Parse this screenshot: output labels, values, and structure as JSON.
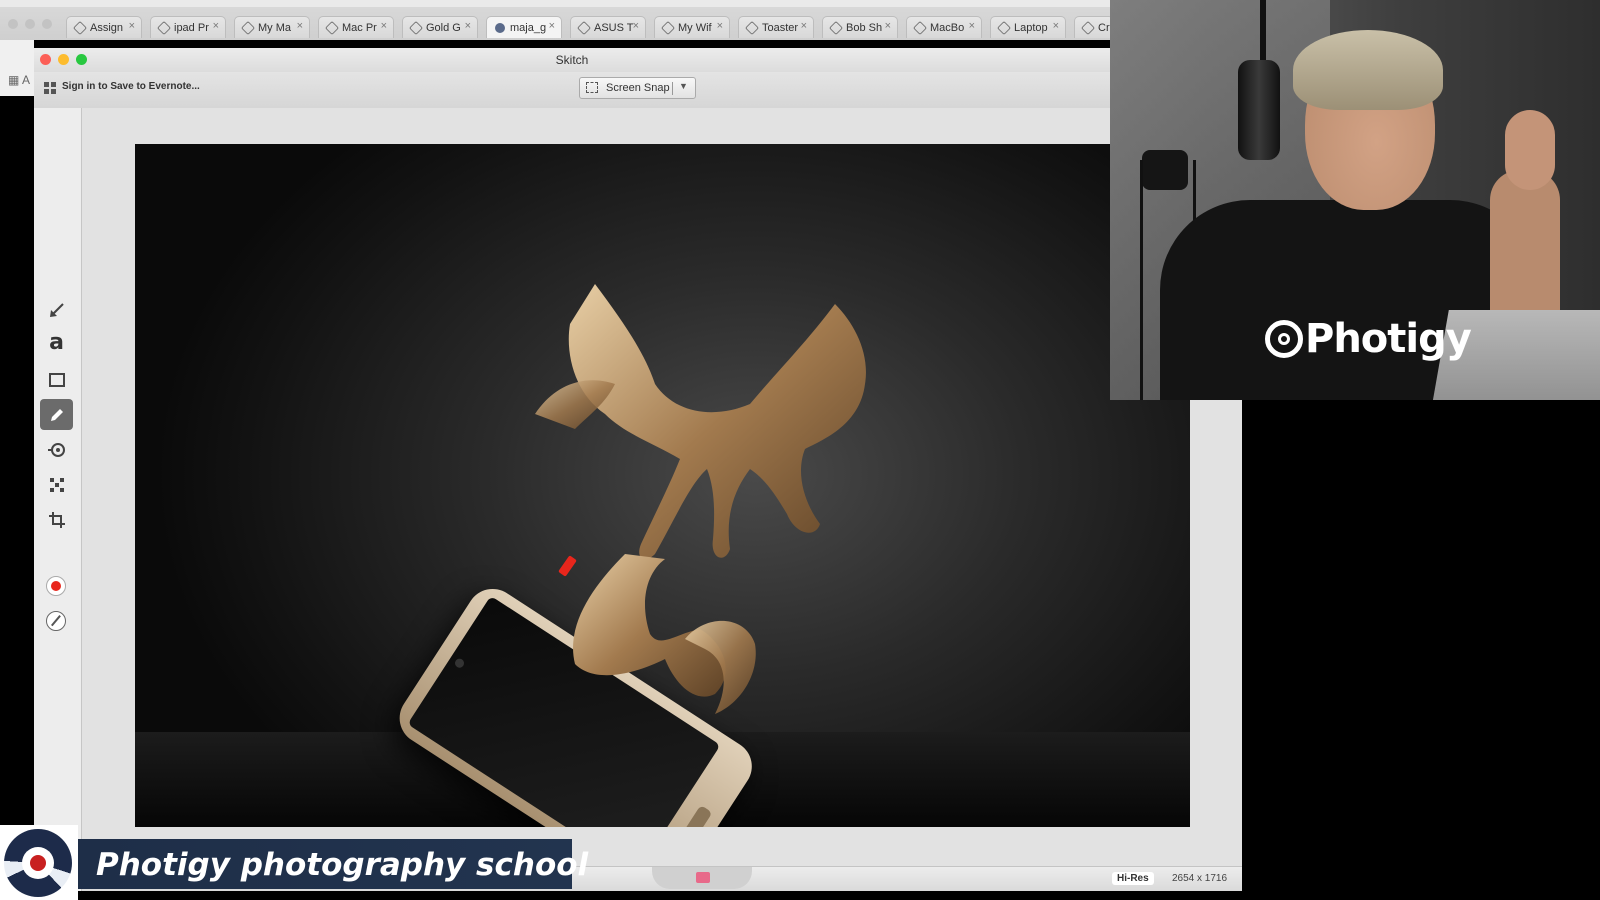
{
  "browser": {
    "tabs": [
      {
        "label": "Assign",
        "active": false
      },
      {
        "label": "ipad Pr",
        "active": false
      },
      {
        "label": "My Ma",
        "active": false
      },
      {
        "label": "Mac Pr",
        "active": false
      },
      {
        "label": "Gold G",
        "active": false
      },
      {
        "label": "maja_g",
        "active": true
      },
      {
        "label": "ASUS T",
        "active": false
      },
      {
        "label": "My Wif",
        "active": false
      },
      {
        "label": "Toaster",
        "active": false
      },
      {
        "label": "Bob Sh",
        "active": false
      },
      {
        "label": "MacBo",
        "active": false
      },
      {
        "label": "Laptop",
        "active": false
      },
      {
        "label": "Cr",
        "active": false
      }
    ],
    "tab_close_glyph": "×",
    "apps_label": "A"
  },
  "skitch": {
    "window_title": "Skitch",
    "sign_in_label": "Sign in to Save to Evernote...",
    "screen_snap_label": "Screen Snap",
    "tools": [
      {
        "icon": "arrow-icon",
        "selected": false
      },
      {
        "icon": "text-tool-icon",
        "glyph": "a",
        "selected": false
      },
      {
        "icon": "rectangle-icon",
        "selected": false
      },
      {
        "icon": "pencil-icon",
        "selected": true
      },
      {
        "icon": "stamp-icon",
        "selected": false
      },
      {
        "icon": "pixelate-icon",
        "selected": false
      },
      {
        "icon": "crop-icon",
        "selected": false
      }
    ],
    "current_color": "#e8261c",
    "hires_badge": "Hi-Res",
    "dimensions": "2654 x 1716"
  },
  "overlay": {
    "shirt_logo_text": "Photigy",
    "lower_third_title": "Photigy photography school",
    "brand_navy": "#1e2e48",
    "brand_red": "#c82020"
  }
}
